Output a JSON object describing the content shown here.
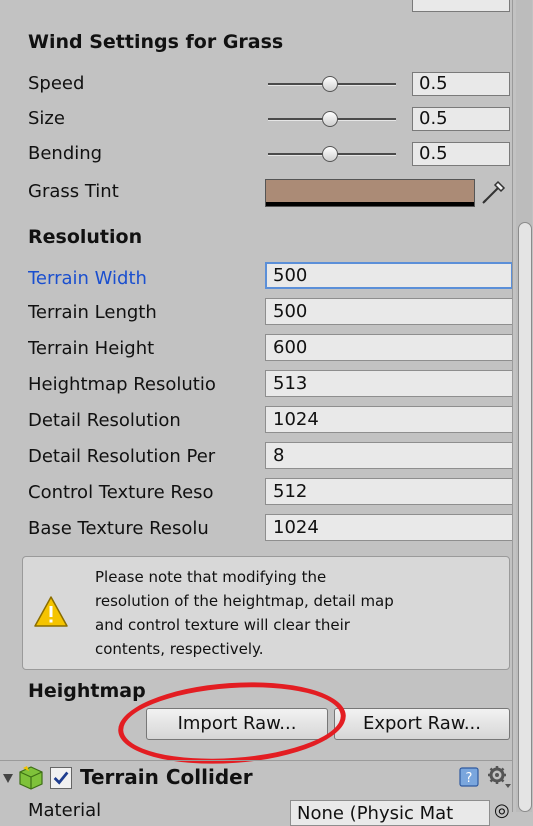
{
  "wind": {
    "title": "Wind Settings for Grass",
    "rows": [
      {
        "label": "Speed",
        "value": "0.5",
        "slider_fraction": 0.5
      },
      {
        "label": "Size",
        "value": "0.5",
        "slider_fraction": 0.5
      },
      {
        "label": "Bending",
        "value": "0.5",
        "slider_fraction": 0.5
      }
    ],
    "grass_tint": {
      "label": "Grass Tint",
      "color": "#ab8b76"
    }
  },
  "resolution": {
    "title": "Resolution",
    "fields": [
      {
        "label": "Terrain Width",
        "value": "500"
      },
      {
        "label": "Terrain Length",
        "value": "500"
      },
      {
        "label": "Terrain Height",
        "value": "600"
      },
      {
        "label": "Heightmap Resolutio",
        "value": "513"
      },
      {
        "label": "Detail Resolution",
        "value": "1024"
      },
      {
        "label": "Detail Resolution Per",
        "value": "8"
      },
      {
        "label": "Control Texture Reso",
        "value": "512"
      },
      {
        "label": "Base Texture Resolu",
        "value": "1024"
      }
    ],
    "help_lines": [
      "Please note that modifying the",
      "resolution of the heightmap, detail map",
      "and control texture will clear their",
      "contents, respectively."
    ]
  },
  "heightmap": {
    "title": "Heightmap",
    "import_label": "Import Raw...",
    "export_label": "Export Raw..."
  },
  "terrain_collider": {
    "title": "Terrain Collider",
    "material_label": "Material",
    "material_value": "None (Physic Mat",
    "material_picker": "◎"
  },
  "colors": {
    "panel": "#c2c2c2",
    "active_label": "#1a4fcf",
    "annotation": "#e31d22",
    "help_icon_blue": "#5b8fd8"
  }
}
